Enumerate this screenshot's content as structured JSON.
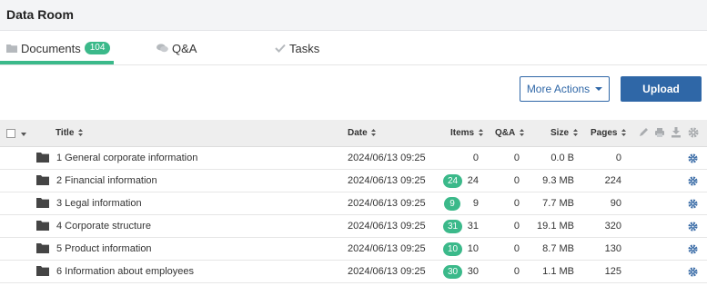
{
  "app": {
    "title": "Data Room"
  },
  "tabs": {
    "documents": {
      "label": "Documents",
      "count": "104"
    },
    "qa": {
      "label": "Q&A"
    },
    "tasks": {
      "label": "Tasks"
    }
  },
  "toolbar": {
    "more_actions_label": "More Actions",
    "upload_label": "Upload"
  },
  "table": {
    "headers": {
      "title": "Title",
      "date": "Date",
      "items": "Items",
      "qa": "Q&A",
      "size": "Size",
      "pages": "Pages"
    },
    "header_icons": [
      "pencil-icon",
      "print-icon",
      "download-icon",
      "gear-icon"
    ],
    "rows": [
      {
        "title": "1 General corporate information",
        "date": "2024/06/13 09:25",
        "new_badge": "",
        "items": "0",
        "qa": "0",
        "size": "0.0 B",
        "pages": "0"
      },
      {
        "title": "2 Financial information",
        "date": "2024/06/13 09:25",
        "new_badge": "24",
        "items": "24",
        "qa": "0",
        "size": "9.3 MB",
        "pages": "224"
      },
      {
        "title": "3 Legal information",
        "date": "2024/06/13 09:25",
        "new_badge": "9",
        "items": "9",
        "qa": "0",
        "size": "7.7 MB",
        "pages": "90"
      },
      {
        "title": "4 Corporate structure",
        "date": "2024/06/13 09:25",
        "new_badge": "31",
        "items": "31",
        "qa": "0",
        "size": "19.1 MB",
        "pages": "320"
      },
      {
        "title": "5 Product information",
        "date": "2024/06/13 09:25",
        "new_badge": "10",
        "items": "10",
        "qa": "0",
        "size": "8.7 MB",
        "pages": "130"
      },
      {
        "title": "6 Information about employees",
        "date": "2024/06/13 09:25",
        "new_badge": "30",
        "items": "30",
        "qa": "0",
        "size": "1.1 MB",
        "pages": "125"
      }
    ]
  },
  "colors": {
    "accent": "#3bb98a",
    "primary": "#2f67a7"
  }
}
